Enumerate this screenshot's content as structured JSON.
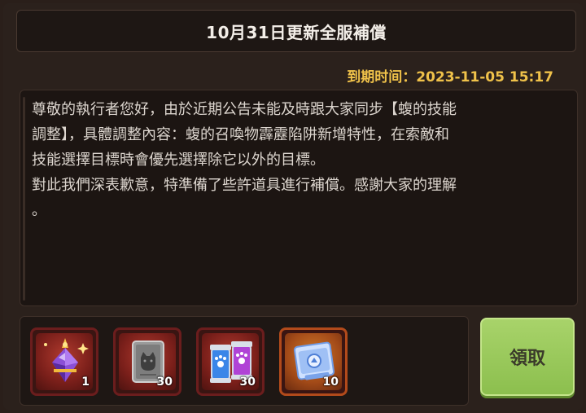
{
  "dialog": {
    "title": "10月31日更新全服補償",
    "expire_label": "到期时间：",
    "expire_value": "2023-11-05 15:17",
    "body_text": "尊敬的執行者您好，由於近期公告未能及時跟大家同步【蝮的技能\n調整】，具體調整內容：蝮的召喚物霹靂陷阱新增特性，在索敵和\n技能選擇目標時會優先選擇除它以外的目標。\n對此我們深表歉意，特準備了些許道具進行補償。感謝大家的理解\n。",
    "claim_label": "領取"
  },
  "rewards": [
    {
      "icon": "potion-crystal-icon",
      "count": "1",
      "frame": "red"
    },
    {
      "icon": "cat-card-icon",
      "count": "30",
      "frame": "red"
    },
    {
      "icon": "paw-canisters-icon",
      "count": "30",
      "frame": "red"
    },
    {
      "icon": "ticket-scroll-icon",
      "count": "10",
      "frame": "orange"
    }
  ],
  "colors": {
    "accent_gold": "#f0c24a",
    "claim_green": "#9ccb5c",
    "frame_red": "#6b1d1d",
    "frame_orange": "#b24a1b"
  }
}
